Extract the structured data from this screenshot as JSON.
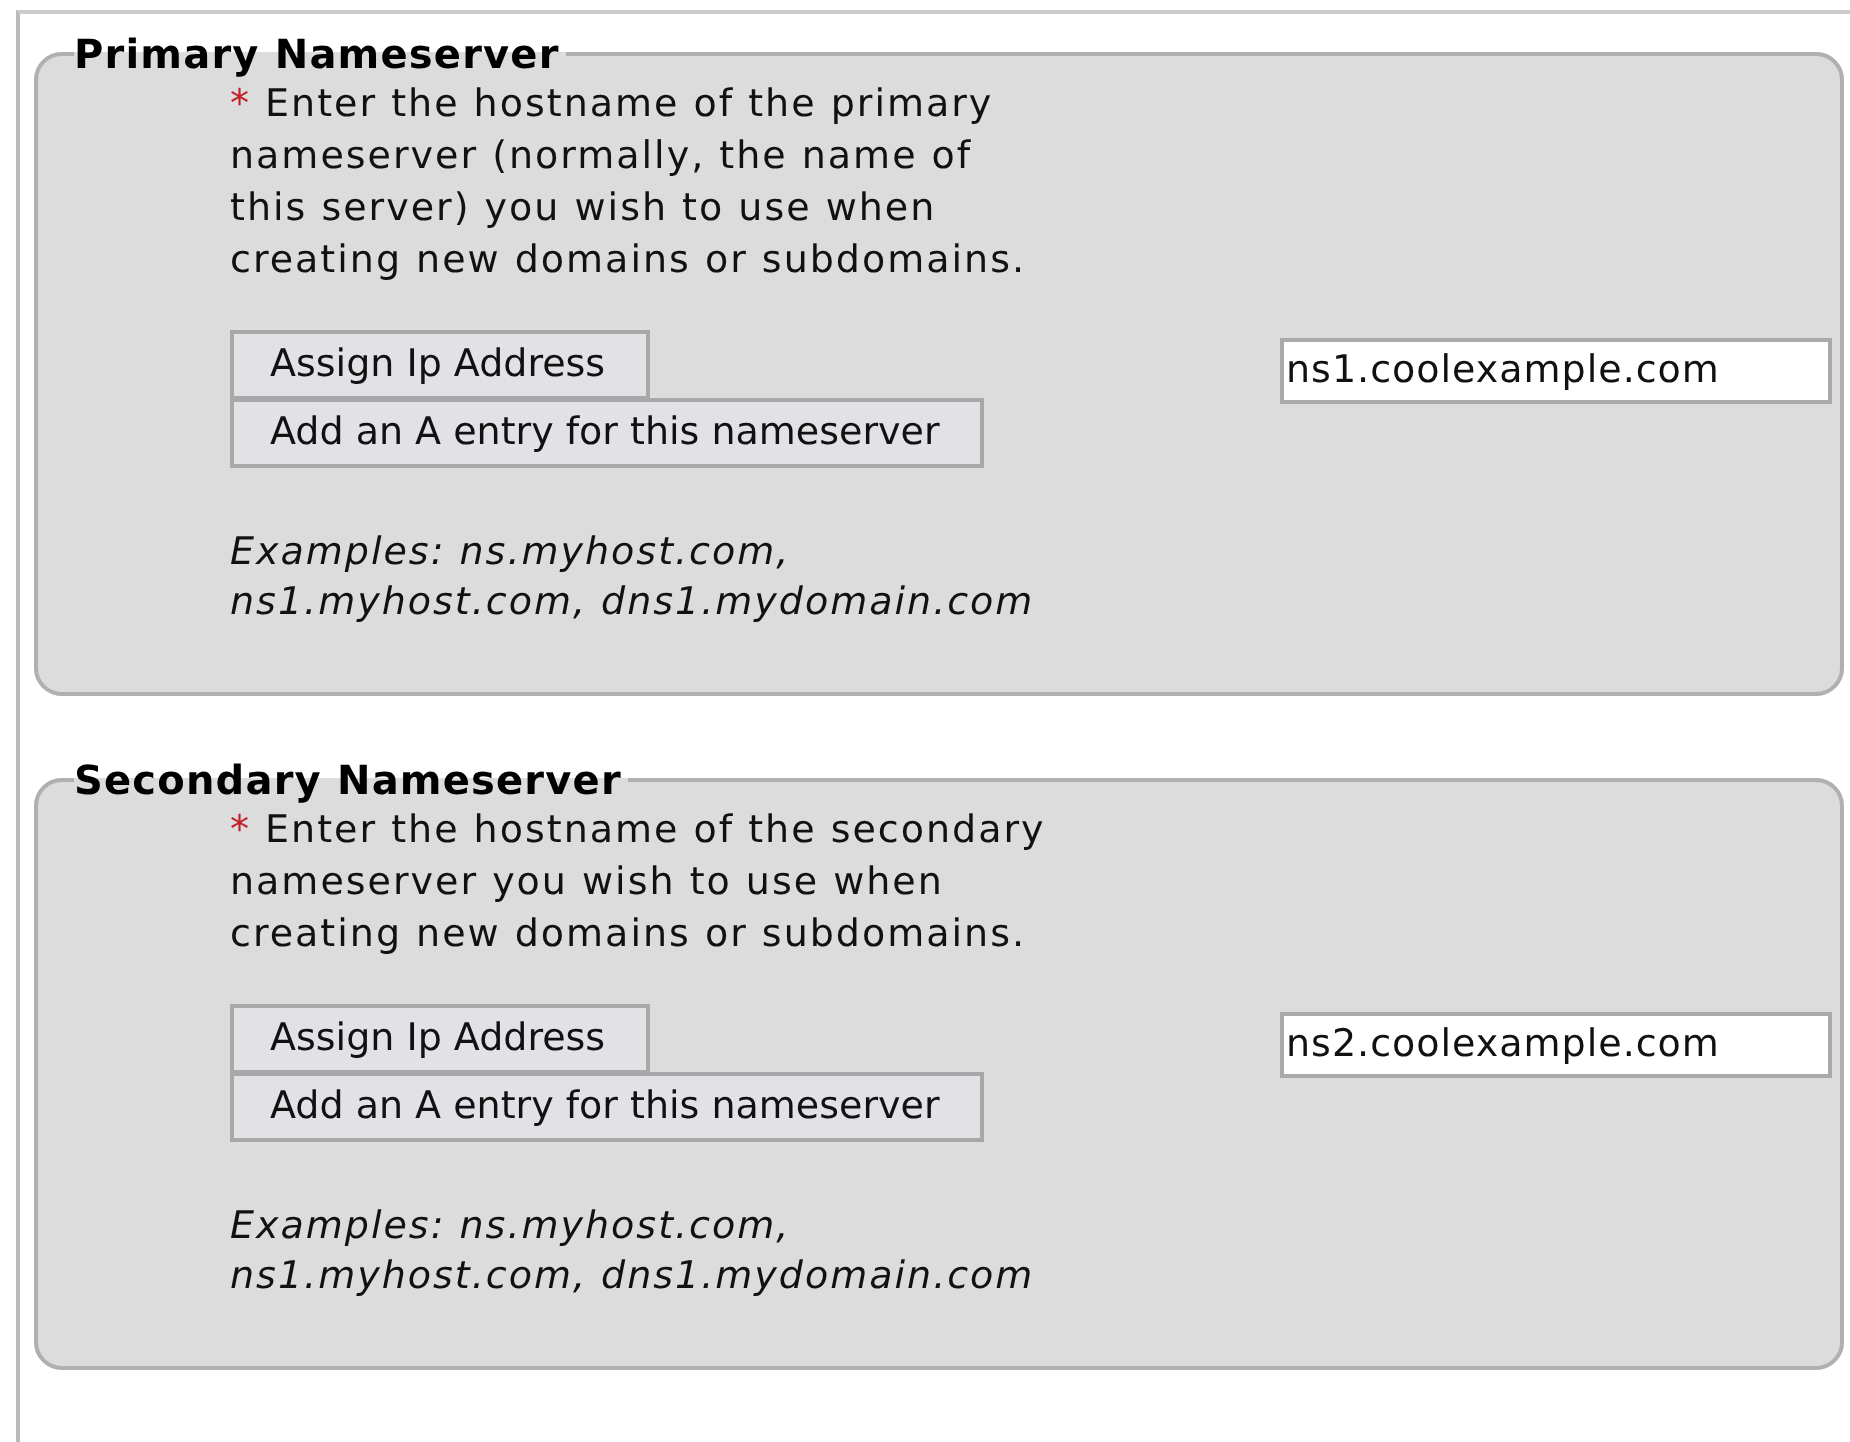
{
  "sections": [
    {
      "legend": "Primary Nameserver",
      "required_mark": "*",
      "description_lines": [
        "Enter the hostname of the primary",
        "nameserver (normally, the name of",
        "this server) you wish to use when",
        "creating new domains or subdomains."
      ],
      "buttons": [
        "Assign Ip Address",
        "Add an A entry for this nameserver"
      ],
      "examples_lines": [
        "Examples: ns.myhost.com,",
        "ns1.myhost.com, dns1.mydomain.com"
      ],
      "value": "ns1.coolexample.com"
    },
    {
      "legend": "Secondary Nameserver",
      "required_mark": "*",
      "description_lines": [
        "Enter the hostname of the secondary",
        "nameserver you wish to use when",
        "creating new domains or subdomains."
      ],
      "buttons": [
        "Assign Ip Address",
        "Add an A entry for this nameserver"
      ],
      "examples_lines": [
        "Examples: ns.myhost.com,",
        "ns1.myhost.com, dns1.mydomain.com"
      ],
      "value": "ns2.coolexample.com"
    }
  ]
}
